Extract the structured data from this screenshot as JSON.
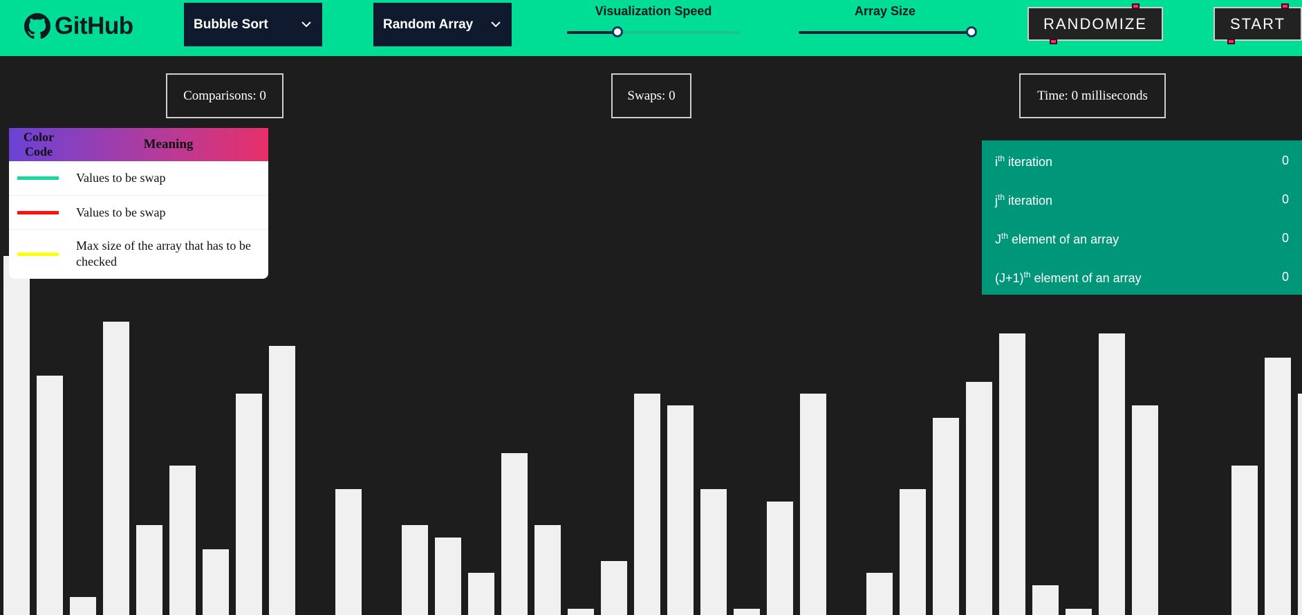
{
  "header": {
    "logo_text": "GitHub",
    "algorithm_select": "Bubble Sort",
    "array_type_select": "Random Array",
    "speed_label": "Visualization Speed",
    "speed_value": 0.3,
    "size_label": "Array Size",
    "size_value": 1.0,
    "randomize_label": "RANDOMIZE",
    "start_label": "START"
  },
  "stats": {
    "comparisons": "Comparisons: 0",
    "swaps": "Swaps: 0",
    "time": "Time: 0 milliseconds"
  },
  "legend": {
    "col1": "Color Code",
    "col2": "Meaning",
    "rows": [
      {
        "color": "#17d6a0",
        "meaning": "Values to be swap"
      },
      {
        "color": "#ff1010",
        "meaning": "Values to be swap"
      },
      {
        "color": "#ffff10",
        "meaning": "Max size of the array that has to be checked"
      }
    ]
  },
  "iterations": {
    "i_sup": "th",
    "i_label": " iteration",
    "i_base": "i",
    "i_value": "0",
    "j_base": "j",
    "j_sup": "th",
    "j_label": " iteration",
    "j_value": "0",
    "jel_base": "J",
    "jel_sup": "th",
    "jel_label": " element of an array",
    "jel_value": "0",
    "j1_base": "(J+1)",
    "j1_sup": "th",
    "j1_label": " element of an array",
    "j1_value": "0"
  },
  "array_values": [
    60,
    40,
    3,
    49,
    15,
    25,
    11,
    37,
    45,
    0,
    21,
    0,
    15,
    13,
    7,
    27,
    15,
    1,
    9,
    37,
    35,
    21,
    1,
    19,
    37,
    0,
    7,
    21,
    33,
    39,
    47,
    5,
    1,
    47,
    35,
    0,
    0,
    25,
    43,
    37
  ],
  "colors": {
    "header_bg": "#00dd95",
    "page_bg": "#1d1d1d",
    "bar": "#f0f0f0",
    "panel": "#00967a"
  }
}
